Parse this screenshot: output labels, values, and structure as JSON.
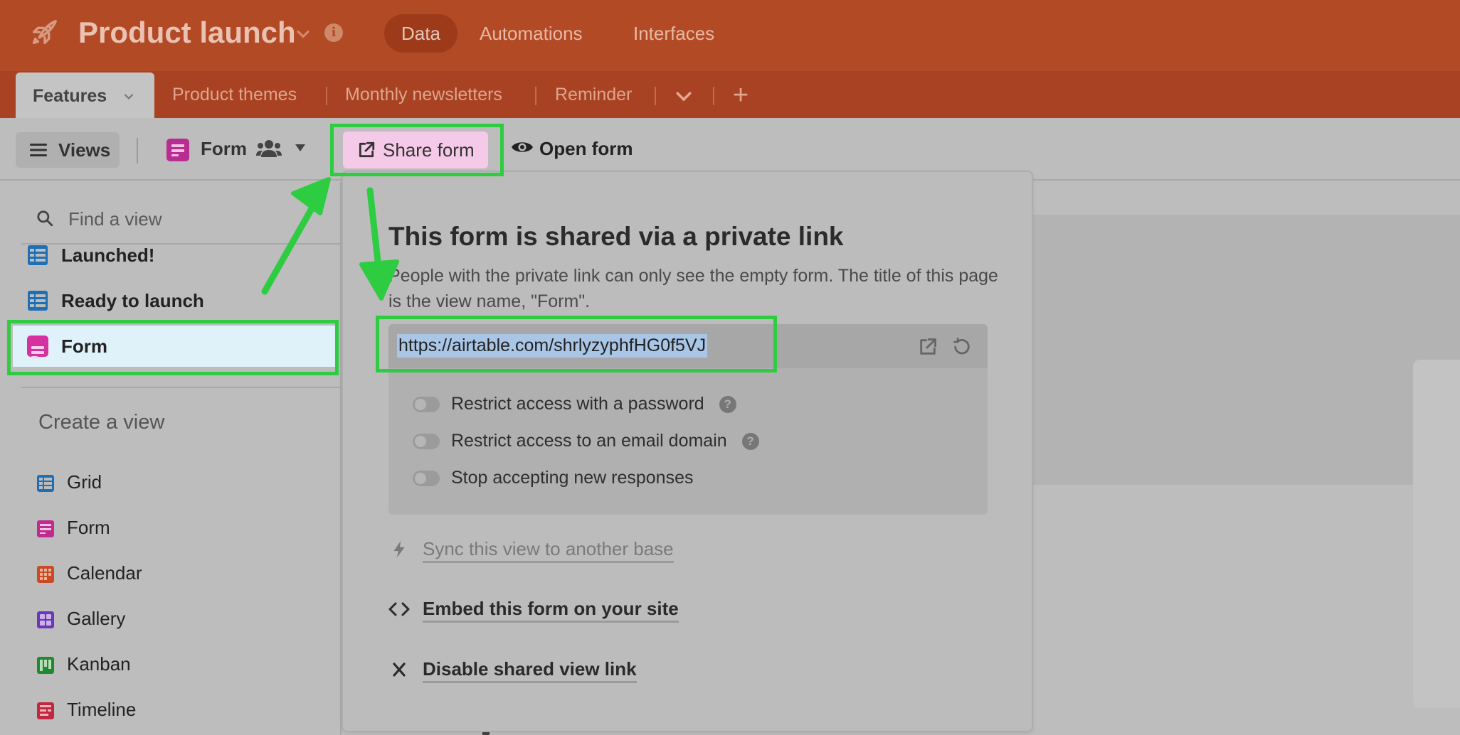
{
  "app": {
    "title": "Product launch",
    "info_symbol": "i",
    "top_tabs": [
      "Data",
      "Automations",
      "Interfaces"
    ],
    "active_top_tab": "Data"
  },
  "tables": {
    "tabs": [
      "Features",
      "Product themes",
      "Monthly newsletters",
      "Reminder"
    ],
    "active": "Features",
    "add_symbol": "+"
  },
  "toolbar": {
    "views_label": "Views",
    "current_view": "Form",
    "share_label": "Share form",
    "open_label": "Open form"
  },
  "sidebar": {
    "find_placeholder": "Find a view",
    "views": [
      {
        "label": "Launched!",
        "type": "grid"
      },
      {
        "label": "Ready to launch",
        "type": "grid"
      },
      {
        "label": "Form",
        "type": "form",
        "selected": true
      }
    ],
    "create_title": "Create a view",
    "create_items": [
      {
        "label": "Grid",
        "color": "#1f6fb5"
      },
      {
        "label": "Form",
        "color": "#c02b8f"
      },
      {
        "label": "Calendar",
        "color": "#c94a24"
      },
      {
        "label": "Gallery",
        "color": "#6b36b8"
      },
      {
        "label": "Kanban",
        "color": "#1f8a2f"
      },
      {
        "label": "Timeline",
        "color": "#c0283f"
      }
    ]
  },
  "popover": {
    "title": "This form is shared via a private link",
    "description": "People with the private link can only see the empty form. The title of this page is the view name, \"Form\".",
    "url": "https://airtable.com/shrlyzyphfHG0f5VJ",
    "toggles": [
      {
        "label": "Restrict access with a password",
        "help": true
      },
      {
        "label": "Restrict access to an email domain",
        "help": true
      },
      {
        "label": "Stop accepting new responses",
        "help": false
      }
    ],
    "help_symbol": "?",
    "actions": {
      "sync": "Sync this view to another base",
      "embed": "Embed this form on your site",
      "disable": "Disable shared view link"
    }
  },
  "colors": {
    "topbar": "#b34a26",
    "tabbar": "#a84222",
    "highlight": "#2ecc40",
    "share_button": "#f5c9e8",
    "selected_view": "#dff2fa"
  }
}
